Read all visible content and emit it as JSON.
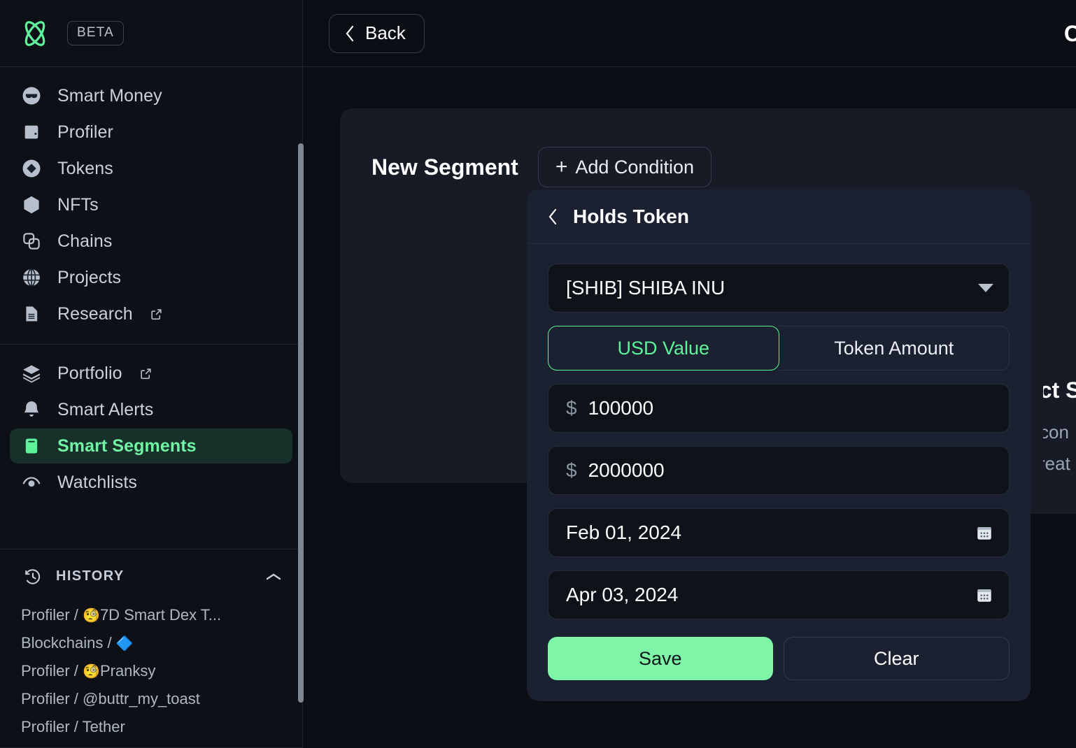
{
  "brand": {
    "badge": "BETA",
    "logo_icon": "atom-knot-logo",
    "accent": "#6ff5a3"
  },
  "sidebar": {
    "groups": [
      {
        "items": [
          {
            "label": "Smart Money",
            "icon": "sunglasses-face-icon",
            "external": false,
            "active": false
          },
          {
            "label": "Profiler",
            "icon": "wallet-icon",
            "external": false,
            "active": false
          },
          {
            "label": "Tokens",
            "icon": "token-diamond-icon",
            "external": false,
            "active": false
          },
          {
            "label": "NFTs",
            "icon": "hexagon-icon",
            "external": false,
            "active": false
          },
          {
            "label": "Chains",
            "icon": "stacked-squares-icon",
            "external": false,
            "active": false
          },
          {
            "label": "Projects",
            "icon": "globe-icon",
            "external": false,
            "active": false
          },
          {
            "label": "Research",
            "icon": "document-icon",
            "external": true,
            "active": false
          }
        ]
      },
      {
        "items": [
          {
            "label": "Portfolio",
            "icon": "layers-icon",
            "external": true,
            "active": false
          },
          {
            "label": "Smart Alerts",
            "icon": "bell-icon",
            "external": false,
            "active": false
          },
          {
            "label": "Smart Segments",
            "icon": "book-icon",
            "external": false,
            "active": true
          },
          {
            "label": "Watchlists",
            "icon": "eye-icon",
            "external": false,
            "active": false
          }
        ]
      }
    ],
    "history": {
      "title": "HISTORY",
      "clock_icon": "history-clock-icon",
      "collapse_icon": "chevron-up-icon",
      "items": [
        {
          "prefix": "Profiler / ",
          "emoji": "🧐",
          "text": "7D Smart Dex T..."
        },
        {
          "prefix": "Blockchains / ",
          "emoji": "🔷",
          "text": ""
        },
        {
          "prefix": "Profiler / ",
          "emoji": "🧐",
          "text": "Pranksy"
        },
        {
          "prefix": "Profiler / ",
          "emoji": "",
          "text": "@buttr_my_toast"
        },
        {
          "prefix": "Profiler / ",
          "emoji": "",
          "text": "Tether"
        }
      ]
    }
  },
  "topbar": {
    "back_label": "Back",
    "back_icon": "chevron-left-icon",
    "right_label": "C"
  },
  "segment_card": {
    "title": "New Segment",
    "add_condition_label": "Add Condition",
    "plus_icon": "plus-icon"
  },
  "right_panel": {
    "title_fragment": "ect S",
    "line1_fragment": "con",
    "line2_fragment": "creat"
  },
  "modal": {
    "back_icon": "chevron-left-icon",
    "title": "Holds Token",
    "token_select": {
      "value": "[SHIB] SHIBA INU",
      "caret_icon": "chevron-down-icon"
    },
    "mode_toggle": {
      "options": [
        "USD Value",
        "Token Amount"
      ],
      "selected": "USD Value"
    },
    "min_value": {
      "currency": "$",
      "value": "100000"
    },
    "max_value": {
      "currency": "$",
      "value": "2000000"
    },
    "start_date": {
      "value": "Feb 01, 2024",
      "icon": "calendar-icon"
    },
    "end_date": {
      "value": "Apr 03, 2024",
      "icon": "calendar-icon"
    },
    "save_label": "Save",
    "clear_label": "Clear"
  }
}
